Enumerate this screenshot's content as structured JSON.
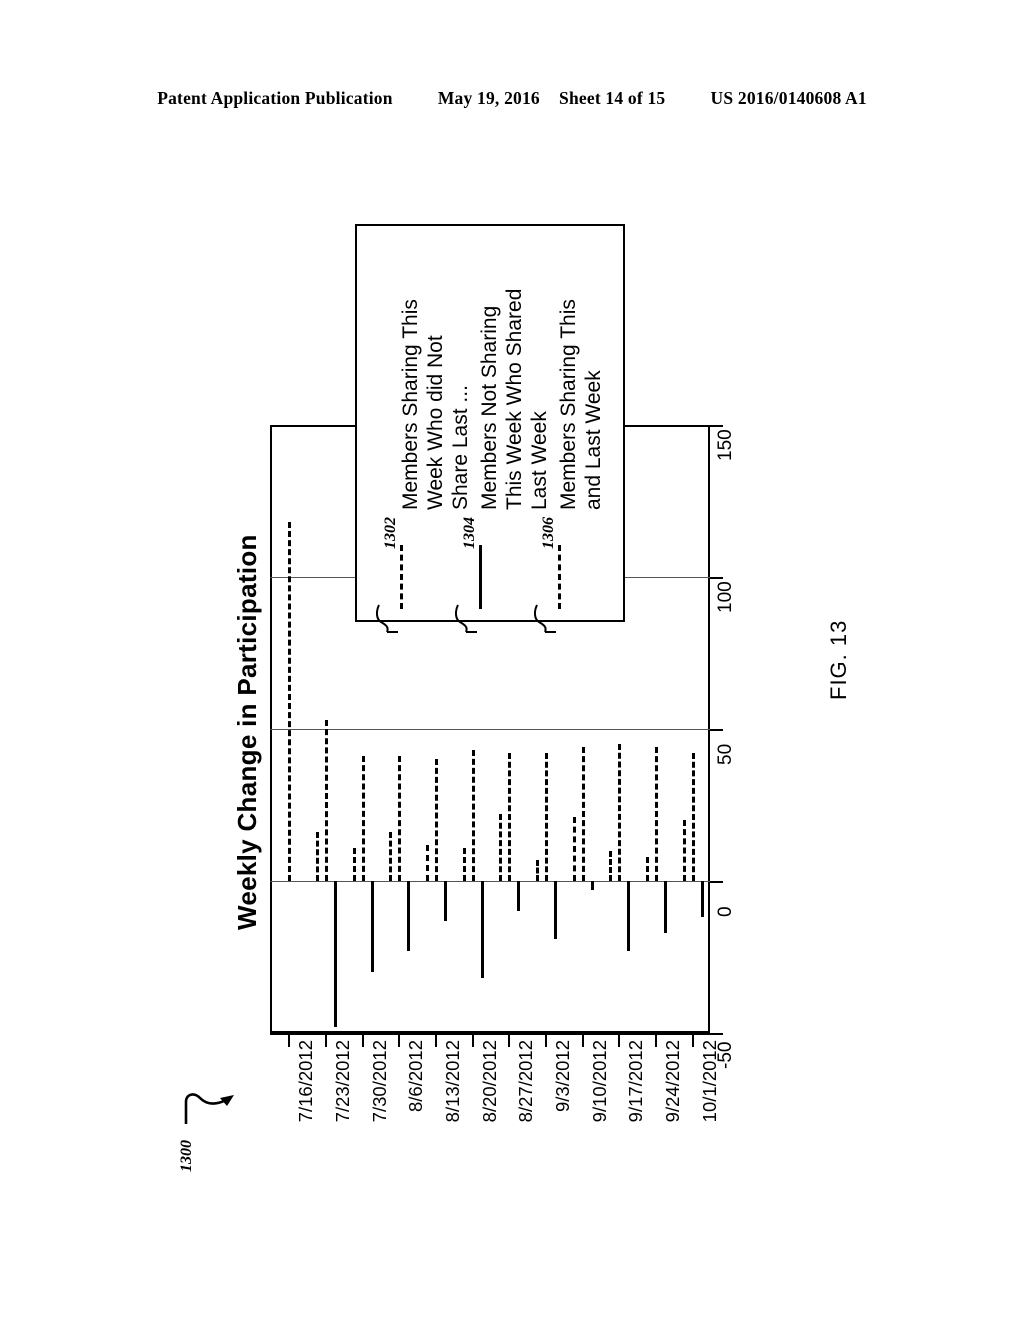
{
  "header": {
    "publication": "Patent Application Publication",
    "date": "May 19, 2016",
    "sheet": "Sheet 14 of 15",
    "patent_number": "US 2016/0140608 A1"
  },
  "figure": {
    "label": "FIG. 13",
    "reference_numeral": "1300"
  },
  "legend": {
    "entries": [
      {
        "ref": "1302",
        "label": "Members Sharing This\nWeek Who did Not\nShare Last ...",
        "line_style": "dashed"
      },
      {
        "ref": "1304",
        "label": "Members Not Sharing\nThis Week Who Shared\nLast Week",
        "line_style": "solid"
      },
      {
        "ref": "1306",
        "label": "Members Sharing This\nand Last Week",
        "line_style": "dashed"
      }
    ]
  },
  "chart_data": {
    "type": "bar",
    "title": "Weekly Change in Participation",
    "xlabel": "",
    "ylabel": "",
    "orientation": "rotated-90",
    "grid": true,
    "legend_position": "upper-left-inset",
    "ylim": [
      -50,
      150
    ],
    "yticks": [
      -50,
      0,
      50,
      100,
      150
    ],
    "ytick_labels": [
      "-50",
      "0",
      "50",
      "100",
      "150"
    ],
    "categories": [
      "7/16/2012",
      "7/23/2012",
      "7/30/2012",
      "8/6/2012",
      "8/13/2012",
      "8/20/2012",
      "8/27/2012",
      "9/3/2012",
      "9/10/2012",
      "9/17/2012",
      "9/24/2012",
      "10/1/2012"
    ],
    "series": [
      {
        "name": "Members Sharing This Week Who did Not Share Last ...",
        "ref": "1302",
        "style": "dashed",
        "values": [
          118,
          53,
          41,
          41,
          40,
          43,
          42,
          42,
          44,
          45,
          44,
          42
        ]
      },
      {
        "name": "Members Not Sharing This Week Who Shared Last Week",
        "ref": "1304",
        "style": "solid",
        "values": [
          0,
          -48,
          -30,
          -23,
          -13,
          -32,
          -10,
          -19,
          -3,
          -23,
          -17,
          -12
        ]
      },
      {
        "name": "Members Sharing This and Last Week",
        "ref": "1306",
        "style": "dashed",
        "values": [
          0,
          16,
          11,
          16,
          12,
          11,
          22,
          7,
          21,
          10,
          8,
          20
        ]
      }
    ]
  }
}
